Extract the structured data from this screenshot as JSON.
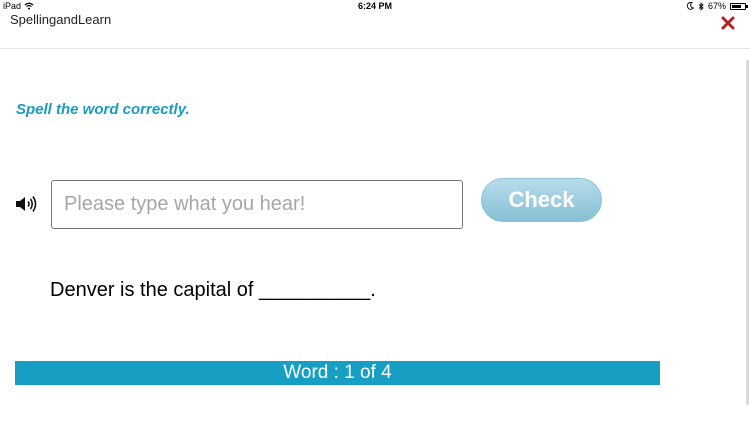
{
  "status_bar": {
    "device": "iPad",
    "time": "6:24 PM",
    "battery": "67%"
  },
  "header": {
    "title": "SpellingandLearn"
  },
  "exercise": {
    "instruction": "Spell the word correctly.",
    "input_value": "",
    "input_placeholder": "Please type what you hear!",
    "check_label": "Check",
    "sentence": "Denver is the capital of __________."
  },
  "progress": {
    "label": "Word : 1 of 4"
  },
  "colors": {
    "accent": "#1a9cbc",
    "progress_bar": "#169fc3",
    "close": "#b22222",
    "check_button": "#9fd0e0"
  },
  "icons": {
    "close": "close-icon",
    "speaker": "speaker-icon",
    "wifi": "wifi-icon",
    "moon": "moon-icon",
    "bluetooth": "bluetooth-icon",
    "battery": "battery-icon"
  }
}
